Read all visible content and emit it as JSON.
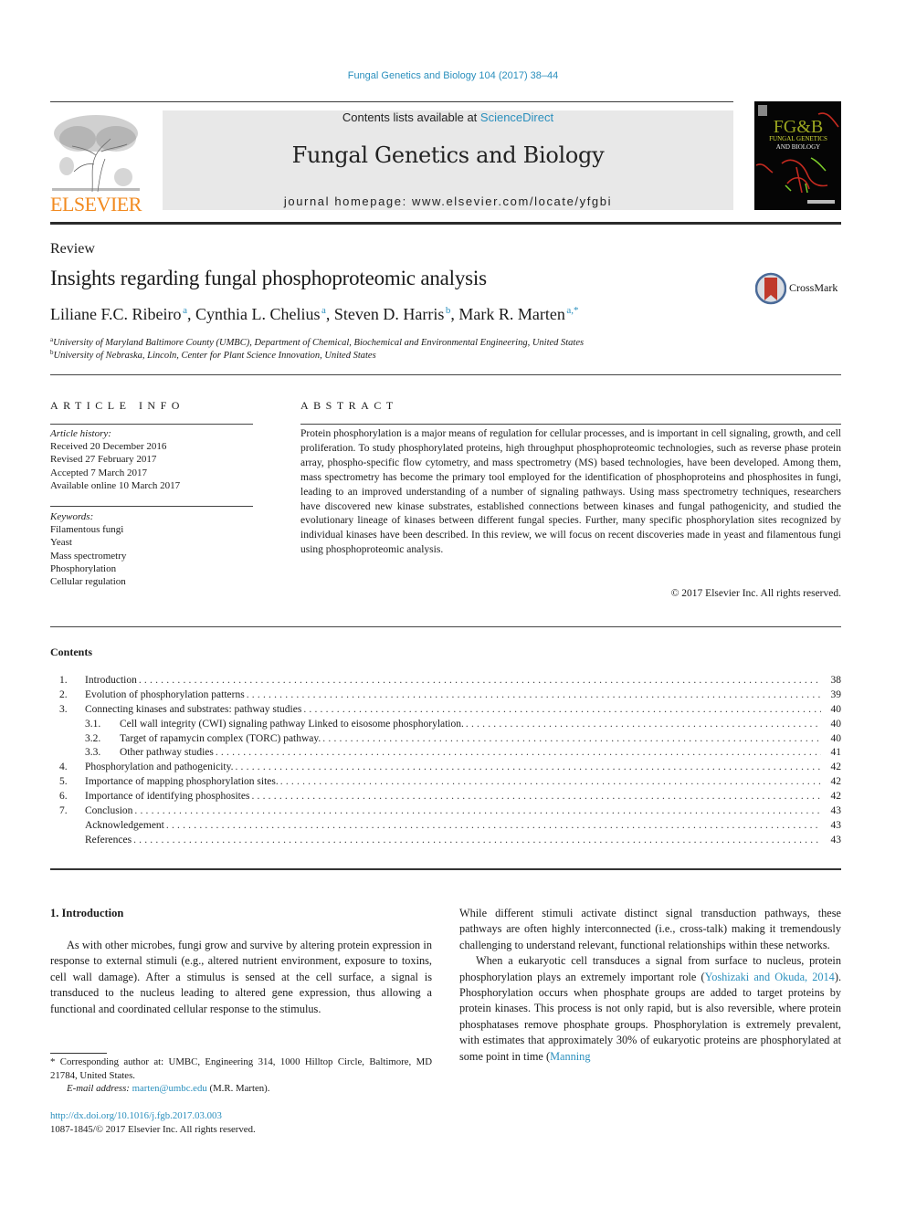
{
  "running_head": "Fungal Genetics and Biology 104 (2017) 38–44",
  "masthead": {
    "publisher_logo": "ELSEVIER",
    "contents_available_prefix": "Contents lists available at ",
    "contents_available_link": "ScienceDirect",
    "journal_title": "Fungal Genetics and Biology",
    "homepage_prefix": "journal homepage: ",
    "homepage_url": "www.elsevier.com/locate/yfgbi",
    "cover_title_line1": "FG&B",
    "cover_title_line2": "FUNGAL GENETICS",
    "cover_title_line3": "AND BIOLOGY"
  },
  "article": {
    "type": "Review",
    "title": "Insights regarding fungal phosphoproteomic analysis",
    "crossmark_label": "CrossMark",
    "authors": [
      {
        "name": "Liliane F.C. Ribeiro",
        "sup": "a"
      },
      {
        "name": "Cynthia L. Chelius",
        "sup": "a"
      },
      {
        "name": "Steven D. Harris",
        "sup": "b"
      },
      {
        "name": "Mark R. Marten",
        "sup": "a,*"
      }
    ],
    "affiliations": [
      {
        "mark": "a",
        "text": "University of Maryland Baltimore County (UMBC), Department of Chemical, Biochemical and Environmental Engineering, United States"
      },
      {
        "mark": "b",
        "text": "University of Nebraska, Lincoln, Center for Plant Science Innovation, United States"
      }
    ]
  },
  "article_info": {
    "heading": "ARTICLE INFO",
    "history_label": "Article history:",
    "history": [
      "Received 20 December 2016",
      "Revised 27 February 2017",
      "Accepted 7 March 2017",
      "Available online 10 March 2017"
    ],
    "keywords_label": "Keywords:",
    "keywords": [
      "Filamentous fungi",
      "Yeast",
      "Mass spectrometry",
      "Phosphorylation",
      "Cellular regulation"
    ]
  },
  "abstract": {
    "heading": "ABSTRACT",
    "text": "Protein phosphorylation is a major means of regulation for cellular processes, and is important in cell signaling, growth, and cell proliferation. To study phosphorylated proteins, high throughput phosphoproteomic technologies, such as reverse phase protein array, phospho-specific flow cytometry, and mass spectrometry (MS) based technologies, have been developed. Among them, mass spectrometry has become the primary tool employed for the identification of phosphoproteins and phosphosites in fungi, leading to an improved understanding of a number of signaling pathways. Using mass spectrometry techniques, researchers have discovered new kinase substrates, established connections between kinases and fungal pathogenicity, and studied the evolutionary lineage of kinases between different fungal species. Further, many specific phosphorylation sites recognized by individual kinases have been described. In this review, we will focus on recent discoveries made in yeast and filamentous fungi using phosphoproteomic analysis.",
    "copyright": "© 2017 Elsevier Inc. All rights reserved."
  },
  "contents": {
    "heading": "Contents",
    "entries": [
      {
        "num": "1.",
        "title": "Introduction",
        "page": "38",
        "level": 1
      },
      {
        "num": "2.",
        "title": "Evolution of phosphorylation patterns",
        "page": "39",
        "level": 1
      },
      {
        "num": "3.",
        "title": "Connecting kinases and substrates: pathway studies",
        "page": "40",
        "level": 1
      },
      {
        "num": "3.1.",
        "title": "Cell wall integrity (CWI) signaling pathway Linked to eisosome phosphorylation.",
        "page": "40",
        "level": 2
      },
      {
        "num": "3.2.",
        "title": "Target of rapamycin complex (TORC) pathway.",
        "page": "40",
        "level": 2
      },
      {
        "num": "3.3.",
        "title": "Other pathway studies",
        "page": "41",
        "level": 2
      },
      {
        "num": "4.",
        "title": "Phosphorylation and pathogenicity.",
        "page": "42",
        "level": 1
      },
      {
        "num": "5.",
        "title": "Importance of mapping phosphorylation sites.",
        "page": "42",
        "level": 1
      },
      {
        "num": "6.",
        "title": "Importance of identifying phosphosites",
        "page": "42",
        "level": 1
      },
      {
        "num": "7.",
        "title": "Conclusion",
        "page": "43",
        "level": 1
      },
      {
        "num": "",
        "title": "Acknowledgement",
        "page": "43",
        "level": 1
      },
      {
        "num": "",
        "title": "References",
        "page": "43",
        "level": 1
      }
    ]
  },
  "body": {
    "intro_heading": "1. Introduction",
    "intro_p1": "As with other microbes, fungi grow and survive by altering protein expression in response to external stimuli (e.g., altered nutrient environment, exposure to toxins, cell wall damage). After a stimulus is sensed at the cell surface, a signal is transduced to the nucleus leading to altered gene expression, thus allowing a functional and coordinated cellular response to the stimulus.",
    "right_p1": "While different stimuli activate distinct signal transduction pathways, these pathways are often highly interconnected (i.e., cross-talk) making it tremendously challenging to understand relevant, functional relationships within these networks.",
    "right_p2_a": "When a eukaryotic cell transduces a signal from surface to nucleus, protein phosphorylation plays an extremely important role (",
    "right_p2_cite1": "Yoshizaki and Okuda, 2014",
    "right_p2_b": "). Phosphorylation occurs when phosphate groups are added to target proteins by protein kinases. This process is not only rapid, but is also reversible, where protein phosphatases remove phosphate groups. Phosphorylation is extremely prevalent, with estimates that approximately 30% of eukaryotic proteins are phosphorylated at some point in time (",
    "right_p2_cite2": "Manning"
  },
  "footnotes": {
    "corresponding": "* Corresponding author at: UMBC, Engineering 314, 1000 Hilltop Circle, Baltimore, MD 21784, United States.",
    "email_label": "E-mail address: ",
    "email": "marten@umbc.edu",
    "email_suffix": " (M.R. Marten).",
    "doi": "http://dx.doi.org/10.1016/j.fgb.2017.03.003",
    "issn": "1087-1845/© 2017 Elsevier Inc. All rights reserved."
  },
  "colors": {
    "link": "#2a8fbd",
    "elsevier_orange": "#f28a1f",
    "masthead_band": "#e8e8e8"
  }
}
